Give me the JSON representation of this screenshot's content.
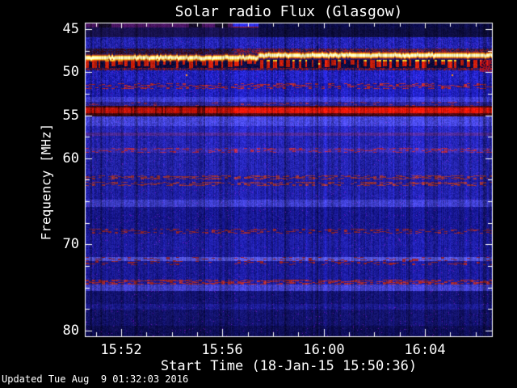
{
  "window": {
    "background_color": "#000000",
    "text_color": "#ffffff",
    "axes_color": "#ffffff"
  },
  "chart_data": {
    "type": "heatmap",
    "subtype": "radio-spectrogram",
    "title": "Solar radio Flux (Glasgow)",
    "xlabel": "Start Time (18-Jan-15 15:50:36)",
    "ylabel": "Frequency [MHz]",
    "updated_note": "Updated Tue Aug  9 01:32:03 2016",
    "x_axis": {
      "start_time": "15:50:36",
      "range_min": [
        0,
        16.05
      ],
      "major_ticks": [
        {
          "label": "15:52",
          "t": 1.4
        },
        {
          "label": "15:56",
          "t": 5.4
        },
        {
          "label": "16:00",
          "t": 9.4
        },
        {
          "label": "16:04",
          "t": 13.4
        }
      ],
      "minor_tick_start_min": 0.4,
      "minor_tick_step_min": 1
    },
    "y_axis": {
      "range_mhz": [
        44.35,
        80.65
      ],
      "direction": "increasing-downward",
      "major_ticks": [
        {
          "label": "45",
          "f": 45
        },
        {
          "label": "50",
          "f": 50
        },
        {
          "label": "55",
          "f": 55
        },
        {
          "label": "60",
          "f": 60
        },
        {
          "label": "70",
          "f": 70
        },
        {
          "label": "80",
          "f": 80
        }
      ],
      "minor_ticks_mhz": [
        47.5,
        52.5,
        57.5,
        62.5,
        65,
        67.5,
        72.5,
        75,
        77.5
      ]
    },
    "features": {
      "seed": 7.3,
      "brightness_step_t": 5.8,
      "emission_line": {
        "left": {
          "f": 48.3,
          "t_end": 6.83
        },
        "right": {
          "f": 48.02,
          "t_start": 6.83
        },
        "core_color": "#fff6c8",
        "mid_color": "#ffd23c",
        "edge_color": "#e85c10"
      }
    },
    "bands": [
      {
        "f0": 44.35,
        "f1": 44.8,
        "kind": "topstripe",
        "left": "#4b1464",
        "mid": "#2a2ad8",
        "right": "#0b0b48",
        "noise": 30
      },
      {
        "f0": 44.8,
        "f1": 45.95,
        "kind": "noise2",
        "left": "#181252",
        "right": "#0d0d40",
        "noise": 26
      },
      {
        "f0": 45.95,
        "f1": 47.3,
        "kind": "noise",
        "color": "#2222ac",
        "noise": 66
      },
      {
        "f0": 47.3,
        "f1": 47.9,
        "kind": "preline",
        "left": "#3a0c22",
        "right": "#7a1830",
        "blue": "#1c1c5e",
        "noise": 50
      },
      {
        "f0": 47.9,
        "f1": 48.55,
        "kind": "noise",
        "color": "#1c1060",
        "noise": 40
      },
      {
        "f0": 48.55,
        "f1": 49.78,
        "kind": "picket",
        "post": "#c81e0a",
        "gap": "#0b0b40",
        "tip": "#f5c828",
        "noise": 40
      },
      {
        "f0": 49.78,
        "f1": 51.25,
        "kind": "noise",
        "color": "#2121bc",
        "noise": 70
      },
      {
        "f0": 51.25,
        "f1": 51.95,
        "kind": "dots",
        "color": "#1b1bac",
        "dot": "#aa2832",
        "density": 0.3,
        "noise": 55
      },
      {
        "f0": 51.95,
        "f1": 52.85,
        "kind": "noise",
        "color": "#1f1fb6",
        "noise": 60
      },
      {
        "f0": 52.85,
        "f1": 53.45,
        "kind": "noise",
        "color": "#3b3bd2",
        "noise": 62
      },
      {
        "f0": 53.45,
        "f1": 53.9,
        "kind": "dots",
        "color": "#2a2294",
        "dot": "#8c2850",
        "density": 0.1,
        "noise": 55
      },
      {
        "f0": 53.9,
        "f1": 55.15,
        "kind": "redband",
        "core": "#dc1608",
        "edge": "#5e0a16",
        "fc": 54.45,
        "coreW": 0.34,
        "noise": 46
      },
      {
        "f0": 55.15,
        "f1": 56.25,
        "kind": "noise",
        "color": "#4444da",
        "noise": 72
      },
      {
        "f0": 56.25,
        "f1": 57.05,
        "kind": "noise",
        "color": "#2828bc",
        "noise": 56
      },
      {
        "f0": 57.05,
        "f1": 57.4,
        "kind": "noise",
        "color": "#4c2a9a",
        "noise": 50
      },
      {
        "f0": 57.4,
        "f1": 58.75,
        "kind": "noise",
        "color": "#2424b2",
        "noise": 54
      },
      {
        "f0": 58.75,
        "f1": 59.4,
        "kind": "dots",
        "color": "#3a2cb2",
        "dot": "#a82848",
        "density": 0.25,
        "noise": 60
      },
      {
        "f0": 59.4,
        "f1": 61.95,
        "kind": "noise",
        "color": "#2222a8",
        "noise": 56
      },
      {
        "f0": 61.95,
        "f1": 62.5,
        "kind": "dots",
        "color": "#1c1c9c",
        "dot": "#90303c",
        "density": 0.45,
        "noise": 50
      },
      {
        "f0": 62.5,
        "f1": 62.7,
        "kind": "noise",
        "color": "#1c1c9c",
        "noise": 48
      },
      {
        "f0": 62.7,
        "f1": 63.2,
        "kind": "dots",
        "color": "#1c1c9c",
        "dot": "#90303c",
        "density": 0.45,
        "noise": 50
      },
      {
        "f0": 63.2,
        "f1": 64.8,
        "kind": "noise",
        "color": "#2020a6",
        "noise": 50
      },
      {
        "f0": 64.8,
        "f1": 65.65,
        "kind": "noise",
        "color": "#3c3cc6",
        "noise": 60
      },
      {
        "f0": 65.65,
        "f1": 68.15,
        "kind": "noise",
        "color": "#17178e",
        "noise": 46
      },
      {
        "f0": 68.15,
        "f1": 68.7,
        "kind": "dots",
        "color": "#17178e",
        "dot": "#8c2430",
        "density": 0.3,
        "noise": 46
      },
      {
        "f0": 68.7,
        "f1": 71.45,
        "kind": "noise",
        "color": "#1c1c9e",
        "noise": 50
      },
      {
        "f0": 71.45,
        "f1": 71.9,
        "kind": "dots",
        "color": "#5050d4",
        "dot": "#8a2030",
        "density": 0.15,
        "noise": 55
      },
      {
        "f0": 71.9,
        "f1": 72.35,
        "kind": "dots",
        "color": "#1a1a96",
        "dot": "#902028",
        "density": 0.18,
        "noise": 46
      },
      {
        "f0": 72.35,
        "f1": 74.05,
        "kind": "noise",
        "color": "#1a1a96",
        "noise": 46
      },
      {
        "f0": 74.05,
        "f1": 74.65,
        "kind": "dots",
        "color": "#1c1c9e",
        "dot": "#a02830",
        "density": 0.5,
        "noise": 50
      },
      {
        "f0": 74.65,
        "f1": 75.4,
        "kind": "noise",
        "color": "#3e3ec8",
        "noise": 56
      },
      {
        "f0": 75.4,
        "f1": 76.9,
        "kind": "noise",
        "color": "#131374",
        "noise": 40
      },
      {
        "f0": 76.9,
        "f1": 77.55,
        "kind": "noise",
        "color": "#1a1a8c",
        "noise": 44
      },
      {
        "f0": 77.55,
        "f1": 79.4,
        "kind": "noise",
        "color": "#12126a",
        "noise": 38
      },
      {
        "f0": 79.4,
        "f1": 80.65,
        "kind": "noise",
        "color": "#0d0d54",
        "noise": 34
      }
    ],
    "hot_pixels": [
      {
        "t": 3.97,
        "f": 50.3,
        "color": "#ff9014"
      },
      {
        "t": 14.44,
        "f": 50.3,
        "color": "#ff8c14"
      },
      {
        "t": 0.25,
        "f": 74.4,
        "color": "#b03040"
      },
      {
        "t": 9.2,
        "f": 48.9,
        "color": "#ffe040"
      }
    ]
  }
}
